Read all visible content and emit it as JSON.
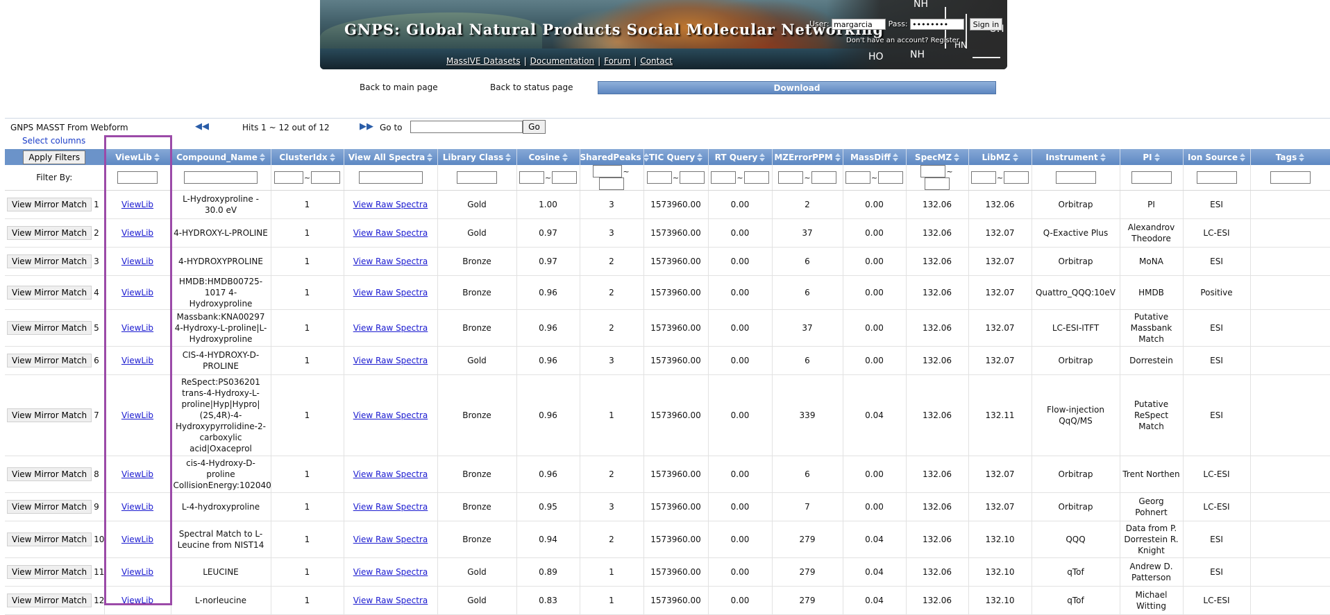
{
  "banner": {
    "title": "GNPS: Global Natural Products Social Molecular Networking",
    "links": [
      "MassIVE Datasets",
      "Documentation",
      "Forum",
      "Contact"
    ],
    "user_label": "User:",
    "user_value": "margarcia",
    "pass_label": "Pass:",
    "pass_value": "••••••••",
    "signin_label": "Sign in",
    "no_account_text": "Don't have an account?",
    "register_label": "Register",
    "molecule_labels": [
      "NH",
      "OH",
      "HO",
      "NH",
      "HN"
    ]
  },
  "nav": {
    "back_main": "Back to main page",
    "back_status": "Back to status page",
    "download": "Download"
  },
  "toolbar": {
    "title": "GNPS MASST From Webform",
    "select_columns": "Select columns",
    "hits": "Hits 1 ~ 12 out of 12",
    "goto_label": "Go to",
    "go_button": "Go",
    "apply_filters": "Apply Filters",
    "filter_by": "Filter By:"
  },
  "columns": [
    "ViewLib",
    "Compound_Name",
    "ClusterIdx",
    "View All Spectra",
    "Library Class",
    "Cosine",
    "SharedPeaks",
    "TIC Query",
    "RT Query",
    "MZErrorPPM",
    "MassDiff",
    "SpecMZ",
    "LibMZ",
    "Instrument",
    "PI",
    "Ion Source",
    "Tags"
  ],
  "row_button_label": "View Mirror Match",
  "viewlib_label": "ViewLib",
  "raw_spectra_label": "View Raw Spectra",
  "rows": [
    {
      "num": "1",
      "compound": "L-Hydroxyproline - 30.0 eV",
      "cluster": "1",
      "libclass": "Gold",
      "cosine": "1.00",
      "shared": "3",
      "tic": "1573960.00",
      "rt": "0.00",
      "ppm": "2",
      "massdiff": "0.00",
      "specmz": "132.06",
      "libmz": "132.06",
      "instrument": "Orbitrap",
      "pi": "PI",
      "ion": "ESI",
      "tags": ""
    },
    {
      "num": "2",
      "compound": "4-HYDROXY-L-PROLINE",
      "cluster": "1",
      "libclass": "Gold",
      "cosine": "0.97",
      "shared": "3",
      "tic": "1573960.00",
      "rt": "0.00",
      "ppm": "37",
      "massdiff": "0.00",
      "specmz": "132.06",
      "libmz": "132.07",
      "instrument": "Q-Exactive Plus",
      "pi": "Alexandrov Theodore",
      "ion": "LC-ESI",
      "tags": ""
    },
    {
      "num": "3",
      "compound": "4-HYDROXYPROLINE",
      "cluster": "1",
      "libclass": "Bronze",
      "cosine": "0.97",
      "shared": "2",
      "tic": "1573960.00",
      "rt": "0.00",
      "ppm": "6",
      "massdiff": "0.00",
      "specmz": "132.06",
      "libmz": "132.07",
      "instrument": "Orbitrap",
      "pi": "MoNA",
      "ion": "ESI",
      "tags": ""
    },
    {
      "num": "4",
      "compound": "HMDB:HMDB00725-1017 4-Hydroxyproline",
      "cluster": "1",
      "libclass": "Bronze",
      "cosine": "0.96",
      "shared": "2",
      "tic": "1573960.00",
      "rt": "0.00",
      "ppm": "6",
      "massdiff": "0.00",
      "specmz": "132.06",
      "libmz": "132.07",
      "instrument": "Quattro_QQQ:10eV",
      "pi": "HMDB",
      "ion": "Positive",
      "tags": ""
    },
    {
      "num": "5",
      "compound": "Massbank:KNA00297 4-Hydroxy-L-proline|L-Hydroxyproline",
      "cluster": "1",
      "libclass": "Bronze",
      "cosine": "0.96",
      "shared": "2",
      "tic": "1573960.00",
      "rt": "0.00",
      "ppm": "37",
      "massdiff": "0.00",
      "specmz": "132.06",
      "libmz": "132.07",
      "instrument": "LC-ESI-ITFT",
      "pi": "Putative Massbank Match",
      "ion": "ESI",
      "tags": ""
    },
    {
      "num": "6",
      "compound": "CIS-4-HYDROXY-D-PROLINE",
      "cluster": "1",
      "libclass": "Gold",
      "cosine": "0.96",
      "shared": "3",
      "tic": "1573960.00",
      "rt": "0.00",
      "ppm": "6",
      "massdiff": "0.00",
      "specmz": "132.06",
      "libmz": "132.07",
      "instrument": "Orbitrap",
      "pi": "Dorrestein",
      "ion": "ESI",
      "tags": ""
    },
    {
      "num": "7",
      "compound": "ReSpect:PS036201 trans-4-Hydroxy-L-proline|Hyp|Hypro|(2S,4R)-4-Hydroxypyrrolidine-2-carboxylic acid|Oxaceprol",
      "cluster": "1",
      "libclass": "Bronze",
      "cosine": "0.96",
      "shared": "1",
      "tic": "1573960.00",
      "rt": "0.00",
      "ppm": "339",
      "massdiff": "0.04",
      "specmz": "132.06",
      "libmz": "132.11",
      "instrument": "Flow-injection QqQ/MS",
      "pi": "Putative ReSpect Match",
      "ion": "ESI",
      "tags": ""
    },
    {
      "num": "8",
      "compound": "cis-4-Hydroxy-D-proline CollisionEnergy:102040",
      "cluster": "1",
      "libclass": "Bronze",
      "cosine": "0.96",
      "shared": "2",
      "tic": "1573960.00",
      "rt": "0.00",
      "ppm": "6",
      "massdiff": "0.00",
      "specmz": "132.06",
      "libmz": "132.07",
      "instrument": "Orbitrap",
      "pi": "Trent Northen",
      "ion": "LC-ESI",
      "tags": ""
    },
    {
      "num": "9",
      "compound": "L-4-hydroxyproline",
      "cluster": "1",
      "libclass": "Bronze",
      "cosine": "0.95",
      "shared": "3",
      "tic": "1573960.00",
      "rt": "0.00",
      "ppm": "7",
      "massdiff": "0.00",
      "specmz": "132.06",
      "libmz": "132.07",
      "instrument": "Orbitrap",
      "pi": "Georg Pohnert",
      "ion": "LC-ESI",
      "tags": ""
    },
    {
      "num": "10",
      "compound": "Spectral Match to L-Leucine from NIST14",
      "cluster": "1",
      "libclass": "Bronze",
      "cosine": "0.94",
      "shared": "2",
      "tic": "1573960.00",
      "rt": "0.00",
      "ppm": "279",
      "massdiff": "0.04",
      "specmz": "132.06",
      "libmz": "132.10",
      "instrument": "QQQ",
      "pi": "Data from P. Dorrestein R. Knight",
      "ion": "ESI",
      "tags": ""
    },
    {
      "num": "11",
      "compound": "LEUCINE",
      "cluster": "1",
      "libclass": "Gold",
      "cosine": "0.89",
      "shared": "1",
      "tic": "1573960.00",
      "rt": "0.00",
      "ppm": "279",
      "massdiff": "0.04",
      "specmz": "132.06",
      "libmz": "132.10",
      "instrument": "qTof",
      "pi": "Andrew D. Patterson",
      "ion": "ESI",
      "tags": ""
    },
    {
      "num": "12",
      "compound": "L-norleucine",
      "cluster": "1",
      "libclass": "Gold",
      "cosine": "0.83",
      "shared": "1",
      "tic": "1573960.00",
      "rt": "0.00",
      "ppm": "279",
      "massdiff": "0.04",
      "specmz": "132.06",
      "libmz": "132.10",
      "instrument": "qTof",
      "pi": "Michael Witting",
      "ion": "LC-ESI",
      "tags": ""
    }
  ],
  "colors": {
    "header_blue": "#6b93c9",
    "highlight_purple": "#9b4aa8",
    "link_blue": "#1a1ad0"
  }
}
